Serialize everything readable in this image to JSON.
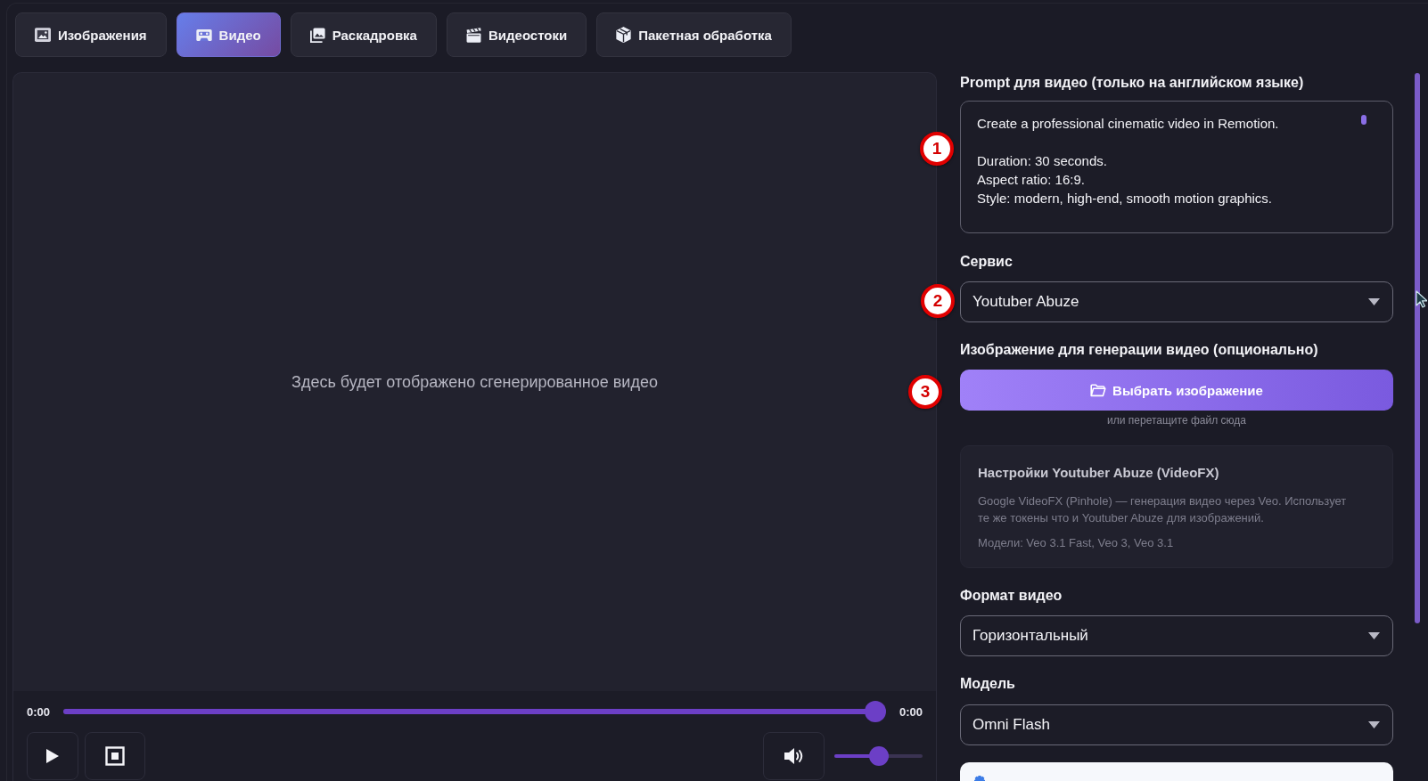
{
  "tabs": [
    {
      "label": "Изображения",
      "selected": false
    },
    {
      "label": "Видео",
      "selected": true
    },
    {
      "label": "Раскадровка",
      "selected": false
    },
    {
      "label": "Видеостоки",
      "selected": false
    },
    {
      "label": "Пакетная обработка",
      "selected": false
    }
  ],
  "preview": {
    "placeholder": "Здесь будет отображено сгенерированное видео"
  },
  "player": {
    "current_time": "0:00",
    "progress": {
      "level": 1
    },
    "duration": "0:00",
    "volume": {
      "level": 0.5
    }
  },
  "settings": {
    "prompt": {
      "label": "Prompt для видео (только на английском языке)",
      "value": "Create a professional cinematic video in Remotion.\n\nDuration: 30 seconds.\nAspect ratio: 16:9.\nStyle: modern, high-end, smooth motion graphics."
    },
    "service": {
      "label": "Сервис",
      "value": "Youtuber Abuze"
    },
    "image": {
      "label": "Изображение для генерации видео (опционально)",
      "button": "Выбрать изображение",
      "hint": "или перетащите файл сюда"
    },
    "service_info": {
      "title": "Настройки Youtuber Abuze (VideoFX)",
      "description": "Google VideoFX (Pinhole) — генерация видео через Veo. Использует те же токены что и Youtuber Abuze для изображений.",
      "models": "Модели: Veo 3.1 Fast, Veo 3, Veo 3.1"
    },
    "format": {
      "label": "Формат видео",
      "value": "Горизонтальный"
    },
    "model": {
      "label": "Модель",
      "value": "Omni Flash"
    }
  },
  "annotations": [
    {
      "label": "1"
    },
    {
      "label": "2"
    },
    {
      "label": "3"
    }
  ]
}
